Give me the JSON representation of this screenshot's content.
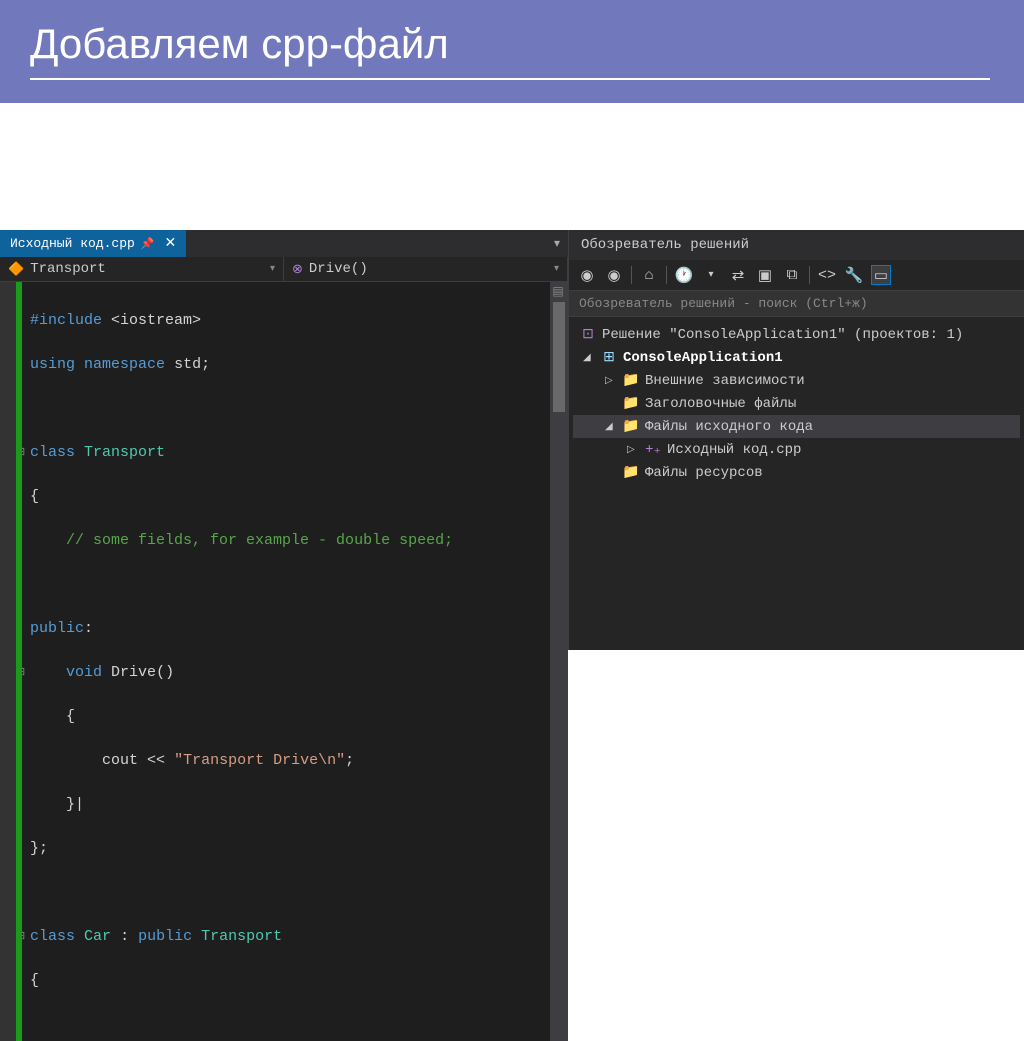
{
  "slide": {
    "title": "Добавляем cpp-файл"
  },
  "editor": {
    "tab_name": "Исходный код.cpp",
    "nav_class": "Transport",
    "nav_method": "Drive()",
    "code": {
      "l1_include_kw": "#include",
      "l1_include_val": "<iostream>",
      "l2_using": "using",
      "l2_namespace": "namespace",
      "l2_std": "std",
      "l4_class": "class",
      "l4_name": "Transport",
      "l6_comment": "// some fields, for example - double speed;",
      "l8_public": "public",
      "l9_void": "void",
      "l9_name": "Drive",
      "l11_cout": "cout",
      "l11_op": "<<",
      "l11_str": "\"Transport Drive\\n\"",
      "l15_class": "class",
      "l15_name": "Car",
      "l15_public": "public",
      "l15_base": "Transport"
    }
  },
  "solution_explorer": {
    "title": "Обозреватель решений",
    "search_placeholder": "Обозреватель решений - поиск (Ctrl+ж)",
    "tree": {
      "solution": "Решение \"ConsoleApplication1\" (проектов: 1)",
      "project": "ConsoleApplication1",
      "ext_deps": "Внешние зависимости",
      "headers": "Заголовочные файлы",
      "sources": "Файлы исходного кода",
      "source_file": "Исходный код.cpp",
      "resources": "Файлы ресурсов"
    }
  }
}
